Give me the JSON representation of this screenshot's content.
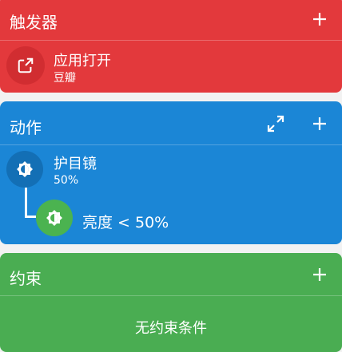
{
  "trigger": {
    "title": "触发器",
    "items": [
      {
        "name": "应用打开",
        "sub": "豆瓣",
        "icon": "open-in-new-icon"
      }
    ]
  },
  "action": {
    "title": "动作",
    "items": [
      {
        "name": "护目镜",
        "sub": "50%",
        "icon": "brightness-icon"
      }
    ],
    "constraint_label": "亮度 < 50%"
  },
  "constraints": {
    "title": "约束",
    "empty_text": "无约束条件"
  },
  "colors": {
    "trigger": "#e3393c",
    "action": "#1b86d6",
    "constraint": "#4aad52"
  }
}
